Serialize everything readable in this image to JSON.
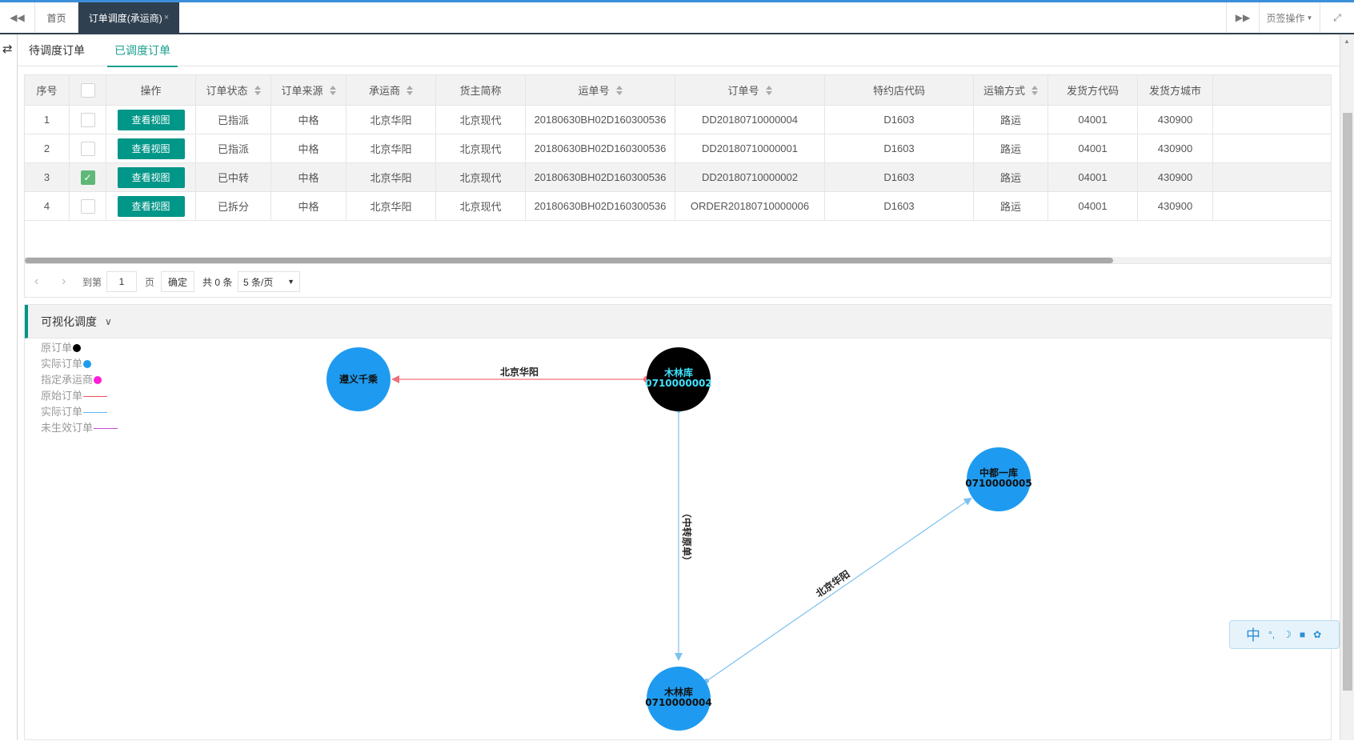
{
  "topbar": {
    "home_tab": "首页",
    "active_tab": "订单调度(承运商)",
    "close_glyph": "×",
    "page_ops": "页签操作"
  },
  "subtabs": [
    "待调度订单",
    "已调度订单"
  ],
  "table": {
    "columns": [
      "序号",
      "",
      "操作",
      "订单状态",
      "订单来源",
      "承运商",
      "货主简称",
      "运单号",
      "订单号",
      "特约店代码",
      "运输方式",
      "发货方代码",
      "发货方城市"
    ],
    "view_button": "查看视图",
    "rows": [
      {
        "no": "1",
        "checked": false,
        "status": "已指派",
        "source": "中格",
        "carrier": "北京华阳",
        "owner": "北京现代",
        "waybill": "20180630BH02D160300536",
        "order": "DD20180710000004",
        "dealer": "D1603",
        "transport": "路运",
        "shipper_code": "04001",
        "shipper_city": "430900"
      },
      {
        "no": "2",
        "checked": false,
        "status": "已指派",
        "source": "中格",
        "carrier": "北京华阳",
        "owner": "北京现代",
        "waybill": "20180630BH02D160300536",
        "order": "DD20180710000001",
        "dealer": "D1603",
        "transport": "路运",
        "shipper_code": "04001",
        "shipper_city": "430900"
      },
      {
        "no": "3",
        "checked": true,
        "status": "已中转",
        "source": "中格",
        "carrier": "北京华阳",
        "owner": "北京现代",
        "waybill": "20180630BH02D160300536",
        "order": "DD20180710000002",
        "dealer": "D1603",
        "transport": "路运",
        "shipper_code": "04001",
        "shipper_city": "430900"
      },
      {
        "no": "4",
        "checked": false,
        "status": "已拆分",
        "source": "中格",
        "carrier": "北京华阳",
        "owner": "北京现代",
        "waybill": "20180630BH02D160300536",
        "order": "ORDER20180710000006",
        "dealer": "D1603",
        "transport": "路运",
        "shipper_code": "04001",
        "shipper_city": "430900"
      }
    ]
  },
  "pager": {
    "goto_label": "到第",
    "page_value": "1",
    "page_unit": "页",
    "confirm": "确定",
    "total": "共 0 条",
    "page_size": "5 条/页"
  },
  "visual": {
    "title": "可视化调度",
    "legend": [
      {
        "label": "原订单",
        "kind": "dot",
        "color": "#000000"
      },
      {
        "label": "实际订单",
        "kind": "dot",
        "color": "#1e9bf0"
      },
      {
        "label": "指定承运商",
        "kind": "dot",
        "color": "#ff1dd8"
      },
      {
        "label": "原始订单",
        "kind": "line",
        "color": "#f0505a"
      },
      {
        "label": "实际订单",
        "kind": "line",
        "color": "#5ab4f0"
      },
      {
        "label": "未生效订单",
        "kind": "line",
        "color": "#c84bd0"
      }
    ],
    "nodes": {
      "zunyi": {
        "line1": "遵义千乘",
        "line2": ""
      },
      "mulin_black": {
        "line1": "木林库",
        "line2": "0710000002"
      },
      "zhongdu": {
        "line1": "中都一库",
        "line2": "0710000005"
      },
      "mulin_blue": {
        "line1": "木林库",
        "line2": "0710000004"
      }
    },
    "edges": {
      "top": "北京华阳",
      "vertical": "（中转原单）",
      "diagonal": "北京华阳"
    }
  },
  "ime": {
    "char": "中"
  },
  "colors": {
    "accent": "#009688",
    "header_dark": "#2f4050",
    "node_blue": "#1e9bf0",
    "check_green": "#5fb878"
  }
}
